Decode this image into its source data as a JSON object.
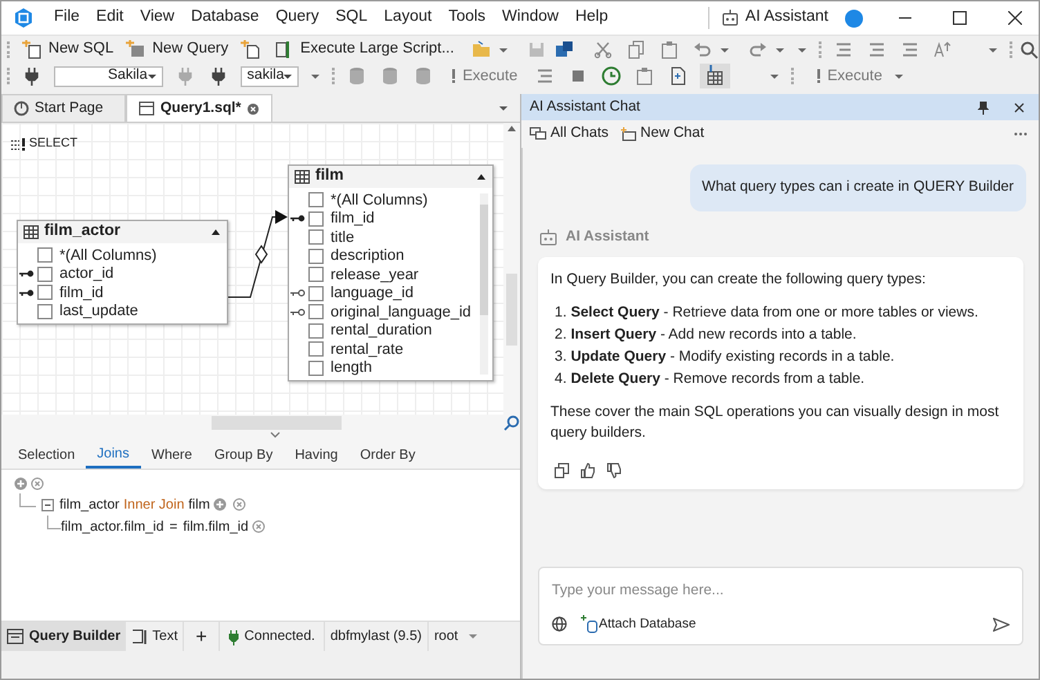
{
  "menu": [
    "File",
    "Edit",
    "View",
    "Database",
    "Query",
    "SQL",
    "Layout",
    "Tools",
    "Window",
    "Help"
  ],
  "title_bar": {
    "assistant_label": "AI Assistant"
  },
  "toolbar_1": {
    "buttons": [
      "New SQL",
      "New Query",
      "Execute Large Script..."
    ]
  },
  "toolbar_2": {
    "connection": "Sakila",
    "database": "sakila",
    "execute_labels": [
      "Execute",
      "Execute"
    ]
  },
  "doc_tabs": [
    {
      "label": "Start Page",
      "selected": false
    },
    {
      "label": "Query1.sql*",
      "selected": true
    }
  ],
  "canvas": {
    "select_label": "SELECT",
    "tables": [
      {
        "name": "film_actor",
        "columns": [
          {
            "name": "*(All Columns)",
            "kind": "plain",
            "checked": false
          },
          {
            "name": "actor_id",
            "kind": "primary",
            "checked": false
          },
          {
            "name": "film_id",
            "kind": "primary",
            "checked": false
          },
          {
            "name": "last_update",
            "kind": "plain",
            "checked": false
          }
        ]
      },
      {
        "name": "film",
        "columns": [
          {
            "name": "*(All Columns)",
            "kind": "plain",
            "checked": false
          },
          {
            "name": "film_id",
            "kind": "primary",
            "checked": false
          },
          {
            "name": "title",
            "kind": "plain",
            "checked": false
          },
          {
            "name": "description",
            "kind": "plain",
            "checked": false
          },
          {
            "name": "release_year",
            "kind": "plain",
            "checked": false
          },
          {
            "name": "language_id",
            "kind": "foreign",
            "checked": false
          },
          {
            "name": "original_language_id",
            "kind": "foreign",
            "checked": false
          },
          {
            "name": "rental_duration",
            "kind": "plain",
            "checked": false
          },
          {
            "name": "rental_rate",
            "kind": "plain",
            "checked": false
          },
          {
            "name": "length",
            "kind": "plain",
            "checked": false
          }
        ]
      }
    ]
  },
  "query_tabs": [
    {
      "label": "Selection",
      "selected": false
    },
    {
      "label": "Joins",
      "selected": true
    },
    {
      "label": "Where",
      "selected": false
    },
    {
      "label": "Group By",
      "selected": false
    },
    {
      "label": "Having",
      "selected": false
    },
    {
      "label": "Order By",
      "selected": false
    }
  ],
  "joins": {
    "left_table": "film_actor",
    "join_type": "Inner Join",
    "right_table": "film",
    "condition": {
      "left": "film_actor.film_id",
      "operator": "=",
      "right": "film.film_id"
    }
  },
  "bottom_bar": {
    "views": [
      {
        "label": "Query Builder",
        "selected": true
      },
      {
        "label": "Text",
        "selected": false
      }
    ],
    "add": "+",
    "status": "Connected.",
    "server": "dbfmylast (9.5)",
    "user": "root"
  },
  "chat": {
    "title": "AI Assistant Chat",
    "toolbar": [
      "All Chats",
      "New Chat"
    ],
    "user_message": "What query types can i create in QUERY Builder",
    "assistant": {
      "author": "AI Assistant",
      "intro": "In Query Builder, you can create the following query types:",
      "items": [
        "1. **Select Query** - Retrieve data from one or more tables or views.",
        "2. **Insert Query** - Add new records into a table.",
        "3. **Update Query** - Modify existing records in a table.",
        "4. **Delete Query** - Remove records from a table."
      ],
      "outro": "These cover the main SQL operations you can visually design in most query builders."
    },
    "input": {
      "placeholder": "Type your message here...",
      "attach_label": "Attach Database"
    }
  }
}
